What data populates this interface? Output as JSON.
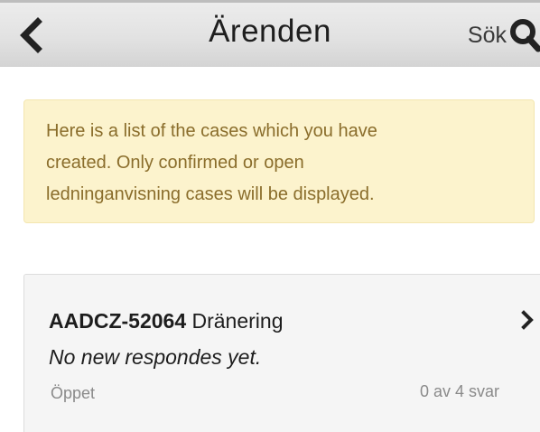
{
  "header": {
    "title": "Ärenden",
    "search_label": "Sök",
    "back_icon": "chevron-left-icon",
    "search_icon": "magnifier-icon"
  },
  "info": {
    "lines": [
      "Here is a list of the cases which you have",
      "created. Only confirmed or open",
      "ledninganvisning cases will be displayed."
    ]
  },
  "cases": [
    {
      "id": "AADCZ-52064",
      "type": "Dränering",
      "subtitle": "No new respondes yet.",
      "status": "Öppet",
      "response_count": "0 av 4 svar",
      "chevron_icon": "chevron-right-icon"
    }
  ],
  "colors": {
    "header_bg": "#e2e2e2",
    "info_bg": "#fcf3cd",
    "info_text": "#8a6d2b",
    "card_bg": "#f5f5f5",
    "muted_text": "#8a8a8a"
  }
}
